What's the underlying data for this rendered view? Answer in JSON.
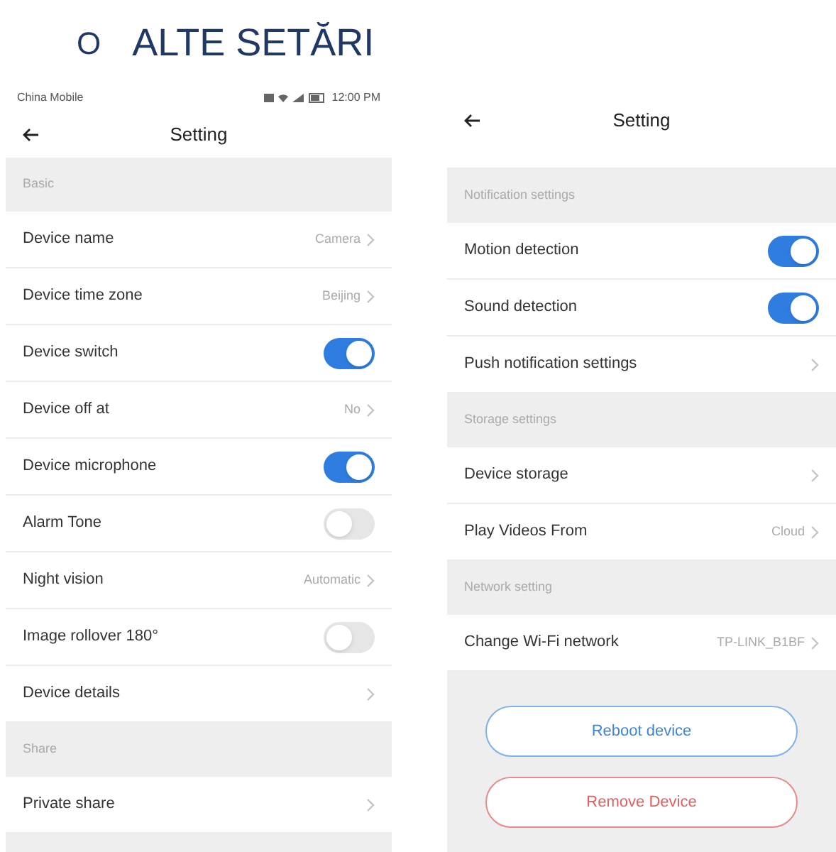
{
  "heading": {
    "bullet": "O",
    "title": "ALTE SETĂRI"
  },
  "screens": [
    {
      "status_bar": {
        "carrier": "China Mobile",
        "time": "12:00 PM"
      },
      "title": "Setting",
      "items": [
        {
          "kind": "section",
          "label": "Basic"
        },
        {
          "kind": "value",
          "label": "Device name",
          "value": "Camera"
        },
        {
          "kind": "value",
          "label": "Device time zone",
          "value": "Beijing"
        },
        {
          "kind": "toggle",
          "label": "Device switch",
          "on": true
        },
        {
          "kind": "value",
          "label": "Device off at",
          "value": "No"
        },
        {
          "kind": "toggle",
          "label": "Device microphone",
          "on": true
        },
        {
          "kind": "toggle",
          "label": "Alarm Tone",
          "on": false
        },
        {
          "kind": "value",
          "label": "Night vision",
          "value": "Automatic"
        },
        {
          "kind": "toggle",
          "label": "Image rollover 180°",
          "on": false
        },
        {
          "kind": "link",
          "label": "Device details"
        },
        {
          "kind": "section",
          "label": "Share"
        },
        {
          "kind": "link",
          "label": "Private share"
        }
      ]
    },
    {
      "title": "Setting",
      "items": [
        {
          "kind": "section",
          "label": "Notification settings"
        },
        {
          "kind": "toggle",
          "label": "Motion detection",
          "on": true
        },
        {
          "kind": "toggle",
          "label": "Sound detection",
          "on": true
        },
        {
          "kind": "link",
          "label": "Push notification settings"
        },
        {
          "kind": "section",
          "label": "Storage settings"
        },
        {
          "kind": "link",
          "label": "Device storage"
        },
        {
          "kind": "value",
          "label": "Play Videos From",
          "value": "Cloud"
        },
        {
          "kind": "section",
          "label": "Network setting"
        },
        {
          "kind": "value",
          "label": "Change Wi-Fi network",
          "value": "TP-LINK_B1BF"
        }
      ],
      "buttons": [
        {
          "label": "Reboot device",
          "kind": "neutral"
        },
        {
          "label": "Remove Device",
          "kind": "danger"
        }
      ]
    }
  ]
}
